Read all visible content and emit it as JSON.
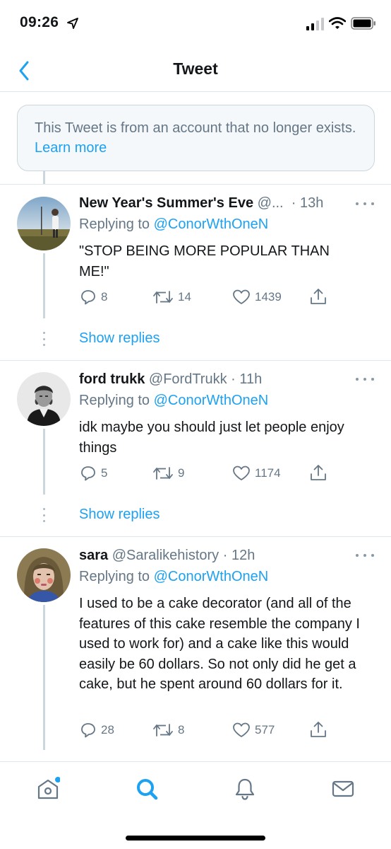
{
  "status_bar": {
    "time": "09:26"
  },
  "nav": {
    "title": "Tweet"
  },
  "notice": {
    "text": "This Tweet is from an account that no longer exists.",
    "link": "Learn more"
  },
  "tweets": [
    {
      "name": "New Year's Summer's Eve",
      "handle": "@...",
      "time": "13h",
      "replying_prefix": "Replying to",
      "replying_handle": "@ConorWthOneN",
      "body": "\"STOP BEING MORE POPULAR THAN ME!\"",
      "replies": "8",
      "retweets": "14",
      "likes": "1439",
      "show_replies": "Show replies"
    },
    {
      "name": "ford trukk",
      "handle": "@FordTrukk",
      "time": "11h",
      "replying_prefix": "Replying to",
      "replying_handle": "@ConorWthOneN",
      "body": "idk maybe you should just let people enjoy things",
      "replies": "5",
      "retweets": "9",
      "likes": "1174",
      "show_replies": "Show replies"
    },
    {
      "name": "sara",
      "handle": "@Saralikehistory",
      "time": "12h",
      "replying_prefix": "Replying to",
      "replying_handle": "@ConorWthOneN",
      "body": "I used to be a cake decorator (and all of the features of this cake resemble the company I used to work for) and a cake like this would easily be 60 dollars. So not only did he get a cake, but he spent around 60 dollars for it.",
      "replies": "28",
      "retweets": "8",
      "likes": "577"
    }
  ],
  "colors": {
    "accent": "#1da1f2",
    "muted": "#657786",
    "text": "#14171a"
  },
  "icons": [
    "location-arrow-icon",
    "signal-icon",
    "wifi-icon",
    "battery-icon",
    "back-chevron-icon",
    "reply-icon",
    "retweet-icon",
    "like-icon",
    "share-icon",
    "more-icon",
    "home-icon",
    "search-icon",
    "notifications-icon",
    "messages-icon"
  ]
}
